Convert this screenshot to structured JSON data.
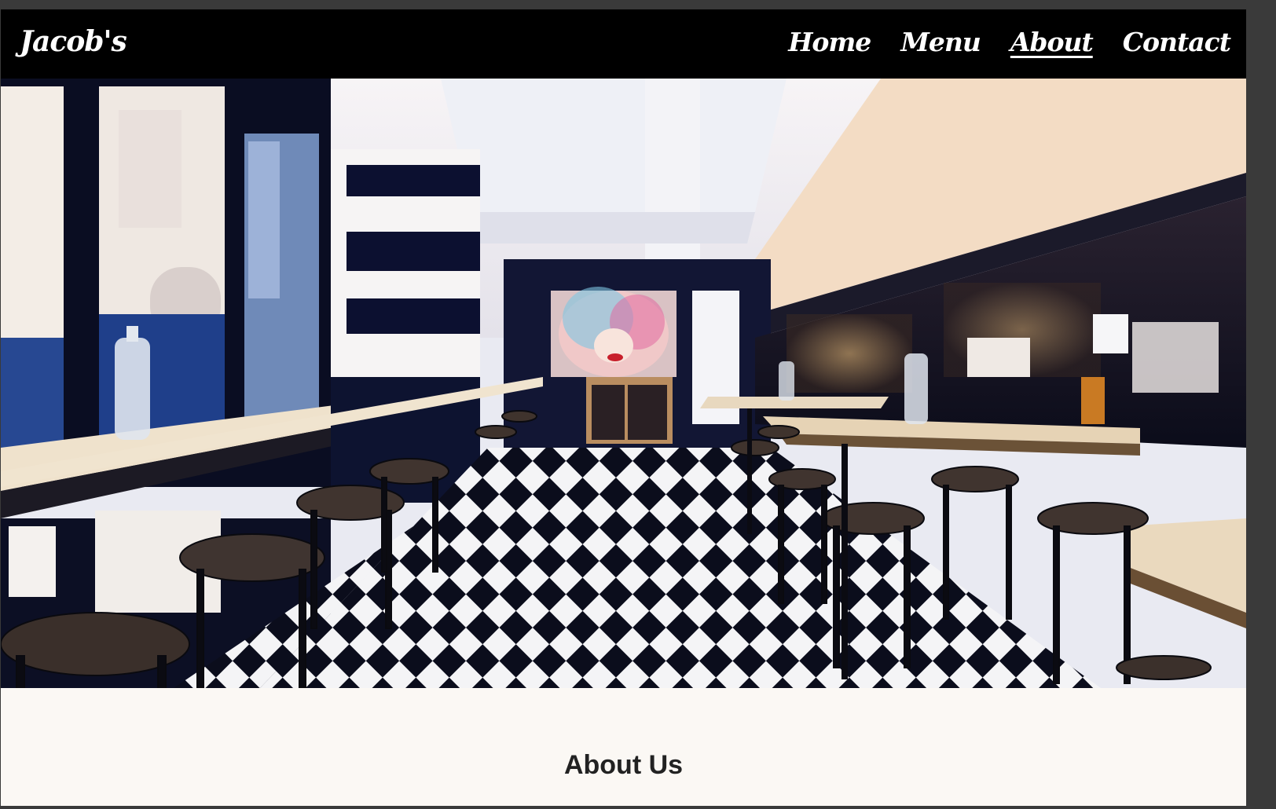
{
  "nav": {
    "brand": "Jacob's",
    "links": [
      {
        "label": "Home",
        "active": false
      },
      {
        "label": "Menu",
        "active": false
      },
      {
        "label": "About",
        "active": true
      },
      {
        "label": "Contact",
        "active": false
      }
    ]
  },
  "hero": {
    "image_description_icon": "diner-interior-photo"
  },
  "about": {
    "title": "About Us"
  },
  "colors": {
    "navbar": "#000000",
    "page_bg": "#fbf8f4",
    "nav_text": "#ffffff",
    "frame": "#3a3a3a"
  }
}
